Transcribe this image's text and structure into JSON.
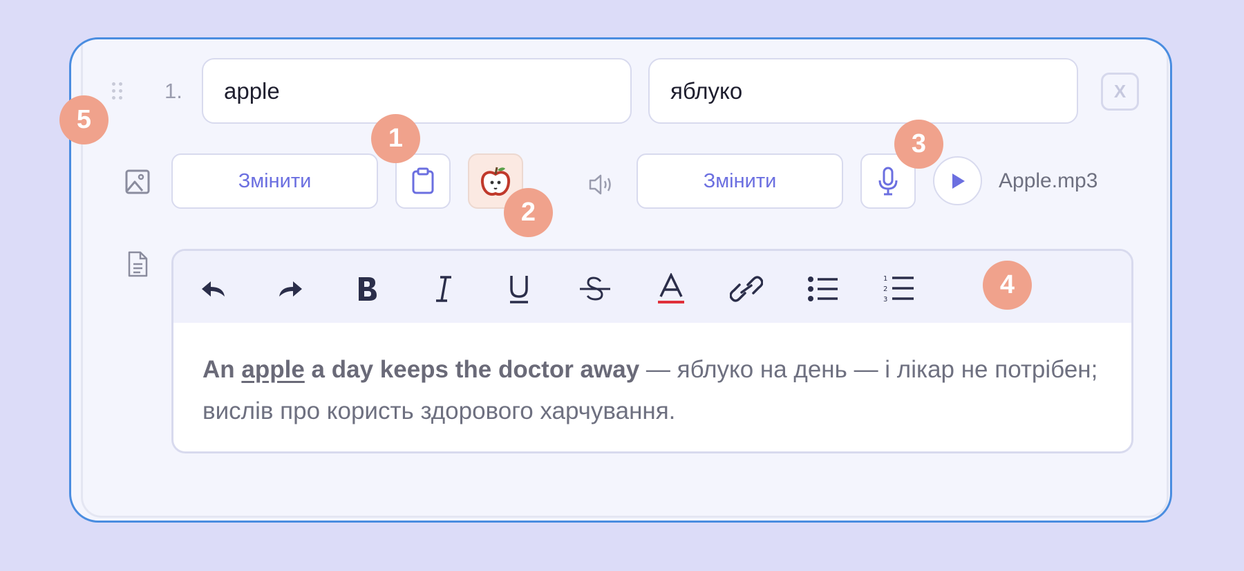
{
  "entry": {
    "number": "1.",
    "term_value": "apple",
    "translation_value": "яблуко",
    "remove_label": "X"
  },
  "media": {
    "change_image_label": "Змінити",
    "change_audio_label": "Змінити",
    "audio_file_name": "Apple.mp3"
  },
  "editor": {
    "toolbar": [
      "undo-icon",
      "redo-icon",
      "bold-icon",
      "italic-icon",
      "underline-icon",
      "strikethrough-icon",
      "text-color-icon",
      "link-icon",
      "bullet-list-icon",
      "numbered-list-icon"
    ],
    "content": {
      "bold_prefix": "An ",
      "bold_underlined": "apple",
      "bold_suffix": " a day keeps the doctor away",
      "plain_text": " — яблуко на день — і лікар не потрібен; вислів про користь здорового харчування."
    }
  },
  "callouts": {
    "badge_1": "1",
    "badge_2": "2",
    "badge_3": "3",
    "badge_4": "4",
    "badge_5": "5"
  },
  "colors": {
    "accent": "#6b6fe0",
    "card_border": "#4a8de0",
    "callout": "#f0a28c",
    "text_color_underline": "#e0303a"
  }
}
